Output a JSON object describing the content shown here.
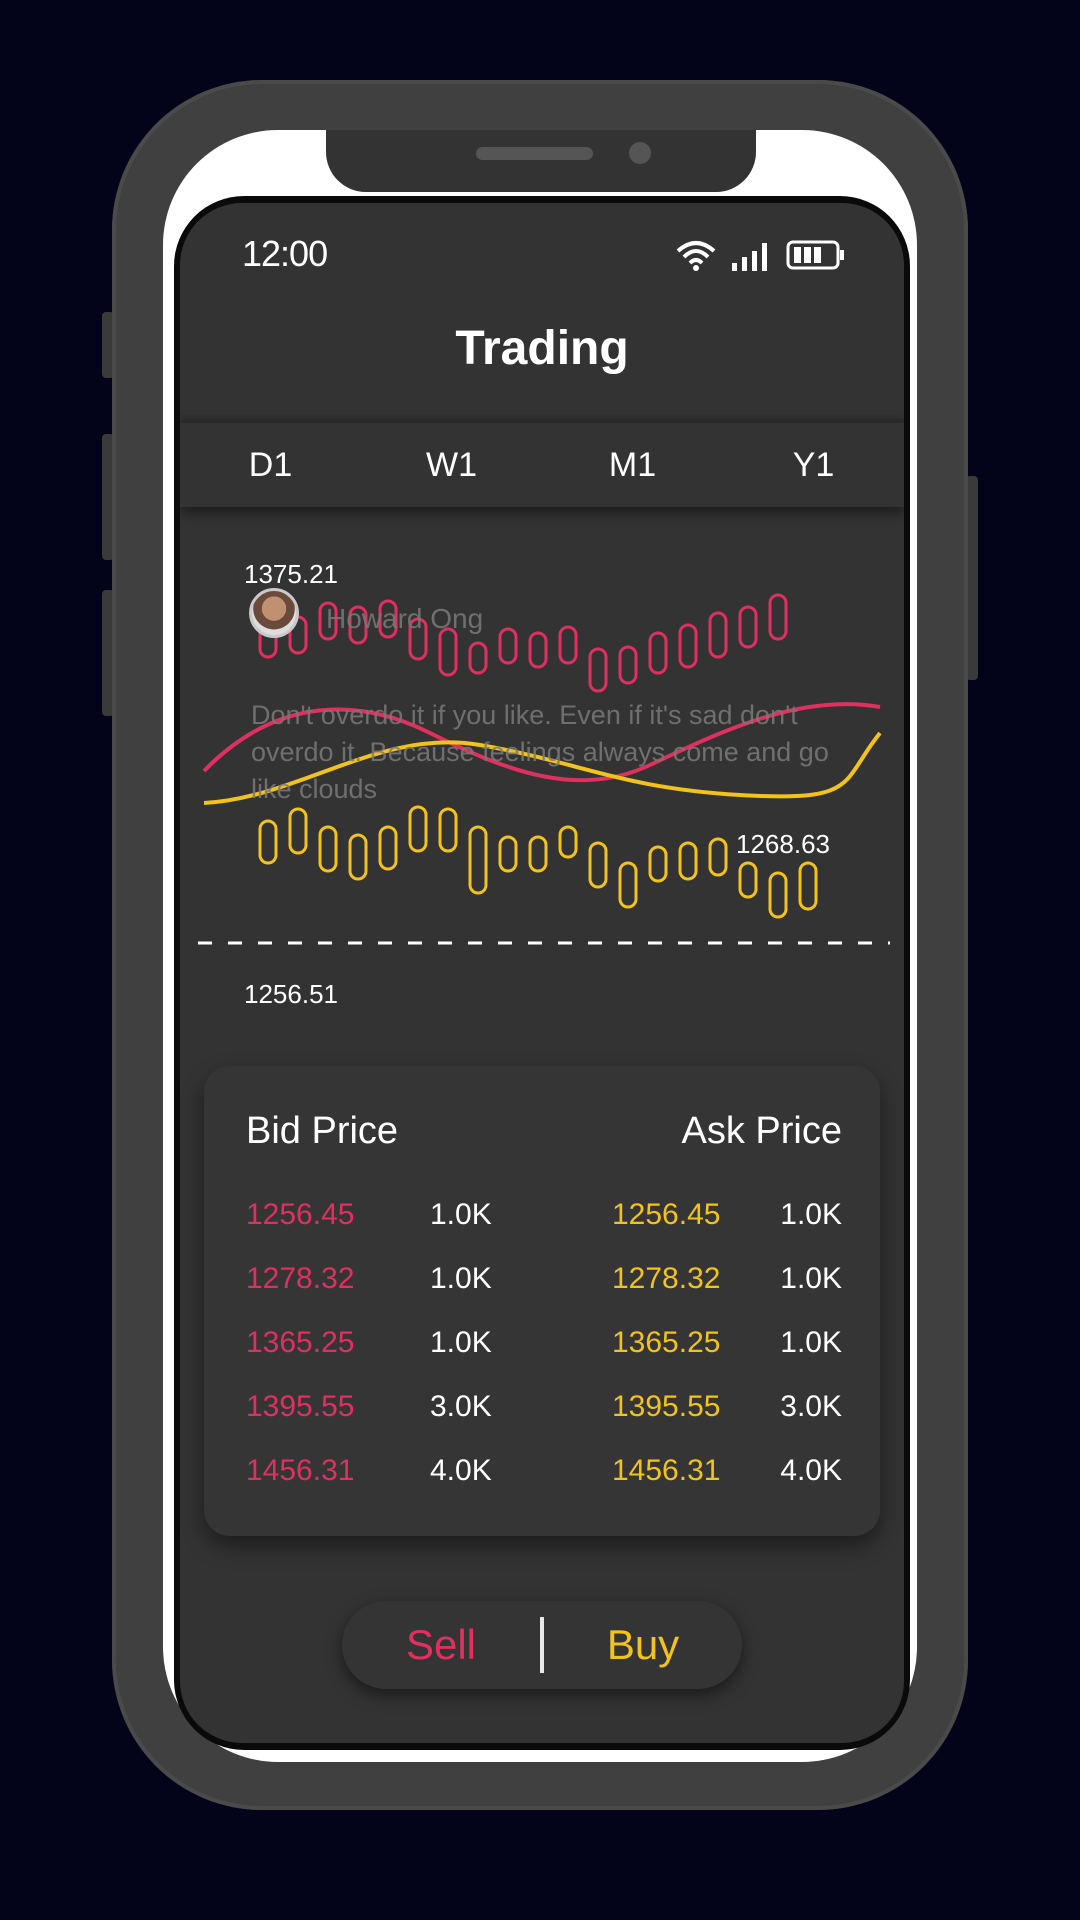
{
  "status_bar": {
    "time": "12:00",
    "icons": [
      "wifi-icon",
      "signal-icon",
      "battery-icon"
    ]
  },
  "header": {
    "title": "Trading"
  },
  "tabs": [
    {
      "label": "D1"
    },
    {
      "label": "W1"
    },
    {
      "label": "M1"
    },
    {
      "label": "Y1"
    }
  ],
  "chart": {
    "high_label": "1375.21",
    "mid_label": "1268.63",
    "low_label": "1256.51",
    "colors": {
      "sell": "#e0305f",
      "buy": "#f2c21d"
    }
  },
  "overlay": {
    "name": "Howard Ong",
    "quote": "Don't overdo it if you like. Even if it's sad don't overdo it. Because feelings always come and go like clouds"
  },
  "order_book": {
    "bid_header": "Bid Price",
    "ask_header": "Ask Price",
    "rows": [
      {
        "bid": "1256.45",
        "bid_qty": "1.0K",
        "ask": "1256.45",
        "ask_qty": "1.0K"
      },
      {
        "bid": "1278.32",
        "bid_qty": "1.0K",
        "ask": "1278.32",
        "ask_qty": "1.0K"
      },
      {
        "bid": "1365.25",
        "bid_qty": "1.0K",
        "ask": "1365.25",
        "ask_qty": "1.0K"
      },
      {
        "bid": "1395.55",
        "bid_qty": "3.0K",
        "ask": "1395.55",
        "ask_qty": "3.0K"
      },
      {
        "bid": "1456.31",
        "bid_qty": "4.0K",
        "ask": "1456.31",
        "ask_qty": "4.0K"
      }
    ]
  },
  "actions": {
    "sell_label": "Sell",
    "buy_label": "Buy"
  }
}
